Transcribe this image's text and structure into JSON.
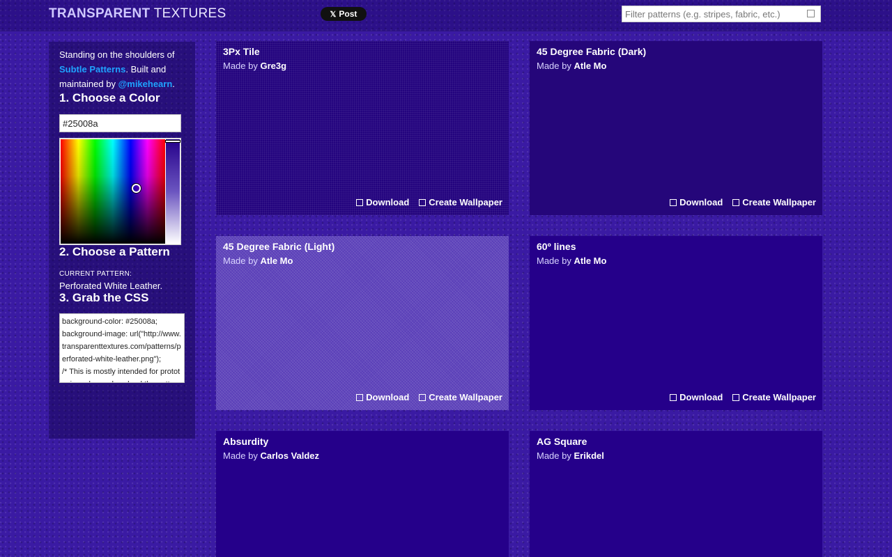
{
  "header": {
    "logo_bold": "TRANSPARENT",
    "logo_light": "TEXTURES",
    "share_icon": "x-logo-icon",
    "share_label": "Post",
    "search_placeholder": "Filter patterns (e.g. stripes, fabric, etc.)"
  },
  "sidebar": {
    "intro_prefix": "Standing on the shoulders of",
    "intro_link1": "Subtle Patterns",
    "intro_mid": ". Built and maintained by",
    "intro_link2": "@mikehearn",
    "intro_end": ".",
    "step1": "1. Choose a Color",
    "color_value": "#25008a",
    "step2": "2. Choose a Pattern",
    "current_label": "CURRENT PATTERN:",
    "current_name": "Perforated White Leather.",
    "step3": "3. Grab the CSS",
    "css_text": "background-color: #25008a;\nbackground-image: url(\"http://www.transparenttextures.com/patterns/perforated-white-leather.png\");\n/* This is mostly intended for prototyping; please download the pattern and re-host for production environments. Thank you! */"
  },
  "made_by_label": "Made by",
  "actions": {
    "download": "Download",
    "wallpaper": "Create Wallpaper"
  },
  "patterns": [
    {
      "name": "3Px Tile",
      "author": "Gre3g"
    },
    {
      "name": "45 Degree Fabric (Dark)",
      "author": "Atle Mo"
    },
    {
      "name": "45 Degree Fabric (Light)",
      "author": "Atle Mo"
    },
    {
      "name": "60º lines",
      "author": "Atle Mo"
    },
    {
      "name": "Absurdity",
      "author": "Carlos Valdez"
    },
    {
      "name": "AG Square",
      "author": "Erikdel"
    }
  ],
  "colors": {
    "background": "#25008a",
    "link": "#1fa3ff"
  }
}
